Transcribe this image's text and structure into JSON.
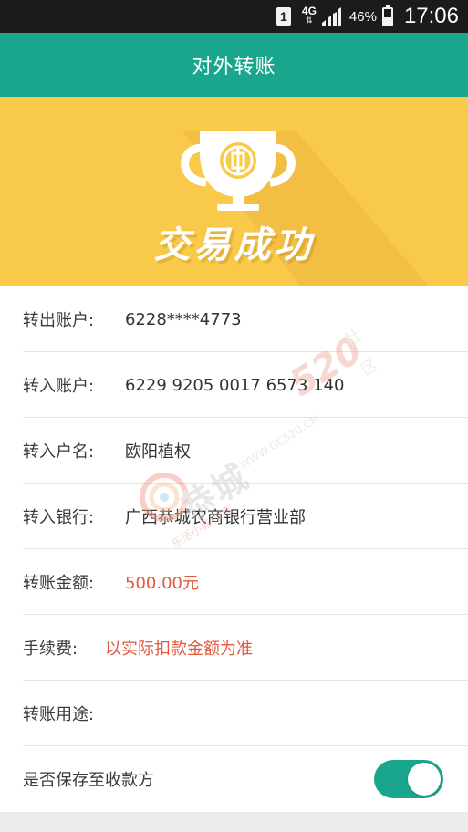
{
  "status_bar": {
    "sim": "1",
    "network": "4G",
    "network_arrows": "⇅",
    "battery": "46%",
    "battery_level": 0.46,
    "time": "17:06"
  },
  "header": {
    "title": "对外转账"
  },
  "banner": {
    "text": "交易成功",
    "icon": "trophy-icon"
  },
  "details": [
    {
      "label": "转出账户:",
      "value": "6228****4773"
    },
    {
      "label": "转入账户:",
      "value": "6229 9205 0017 6573 140"
    },
    {
      "label": "转入户名:",
      "value": "欧阳植权"
    },
    {
      "label": "转入银行:",
      "value": "广西恭城农商银行营业部"
    },
    {
      "label": "转账金额:",
      "value": "500.00元"
    },
    {
      "label": "手续费:",
      "value": "以实际扣款金额为准"
    },
    {
      "label": "转账用途:",
      "value": ""
    }
  ],
  "save_payee": {
    "label": "是否保存至收款方",
    "enabled": true
  },
  "watermark": {
    "main": "恭城",
    "number": "520",
    "she": "社",
    "qu": "区",
    "url": "WWW.GC520.CN",
    "slogan": "乐活小城 故事"
  },
  "colors": {
    "primary": "#1aa68c",
    "banner": "#f9c94a",
    "highlight": "#e0593b"
  }
}
